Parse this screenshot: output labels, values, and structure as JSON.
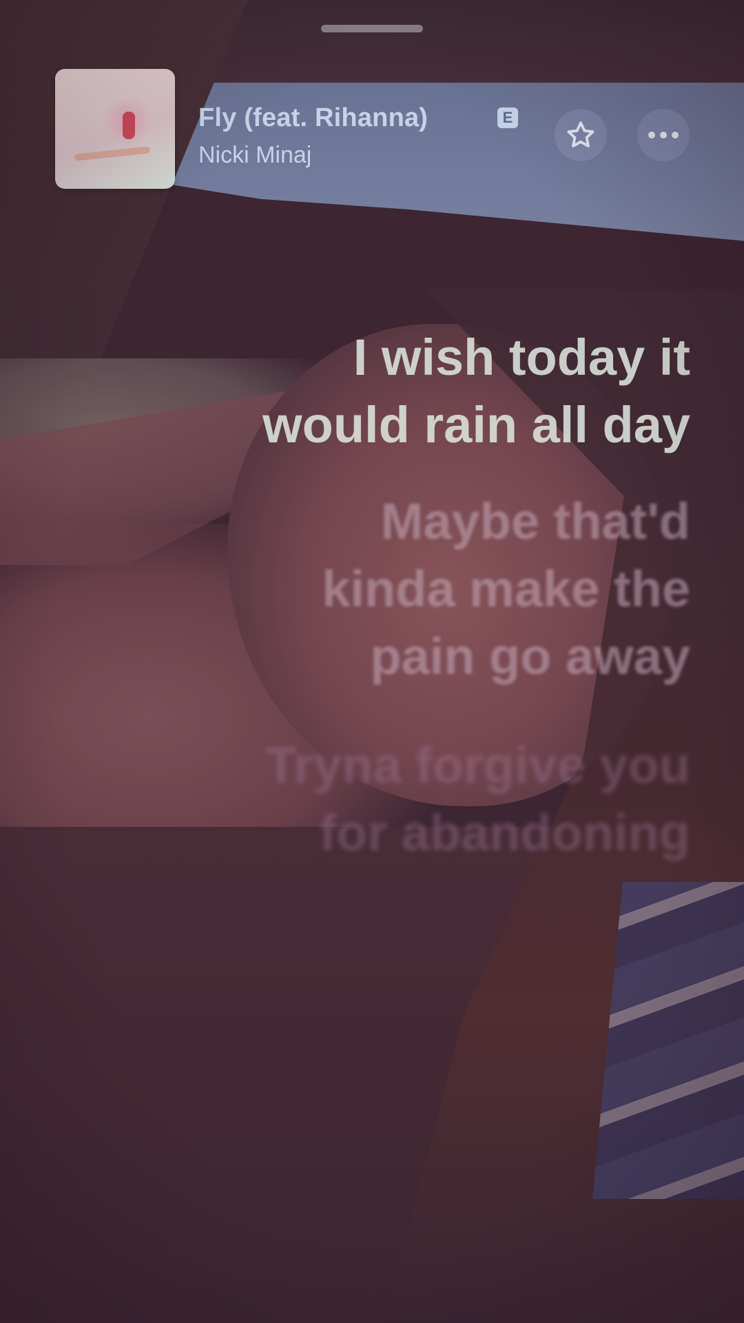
{
  "now_playing": {
    "title": "Fly (feat. Rihanna)",
    "explicit_badge": "E",
    "artist": "Nicki Minaj",
    "favorite_icon": "star-outline-icon",
    "more_icon": "ellipsis-icon"
  },
  "lyrics": {
    "current": [
      "I wish today it",
      "would rain all day"
    ],
    "next": [
      "Maybe that'd",
      "kinda make the",
      "pain go away"
    ],
    "later": [
      "Tryna forgive you",
      "for abandoning"
    ]
  },
  "colors": {
    "title_text": "#c6d4e8",
    "current_lyric": "#e2eae2"
  }
}
